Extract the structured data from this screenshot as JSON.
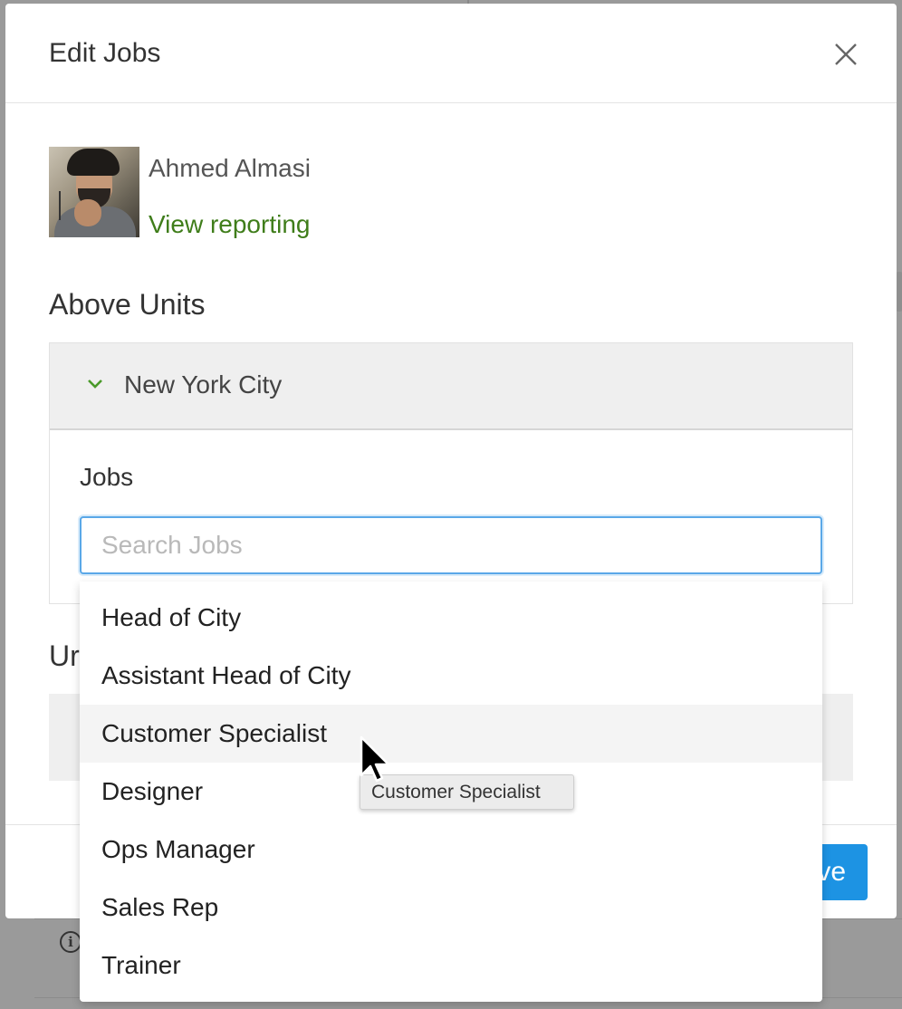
{
  "modal": {
    "title": "Edit Jobs"
  },
  "user": {
    "name": "Ahmed Almasi",
    "view_reporting_link": "View reporting"
  },
  "above_units": {
    "section_title": "Above Units",
    "accordion_label": "New York City",
    "jobs_label": "Jobs",
    "search_placeholder": "Search Jobs",
    "search_value": ""
  },
  "units": {
    "section_title_partial": "Ur"
  },
  "footer": {
    "save_label_partial": "ve"
  },
  "dropdown": {
    "options": [
      "Head of City",
      "Assistant Head of City",
      "Customer Specialist",
      "Designer",
      "Ops Manager",
      "Sales Rep",
      "Trainer"
    ],
    "hovered_option": "Customer Specialist"
  },
  "tooltip": {
    "text": "Customer Specialist"
  },
  "colors": {
    "accent_blue": "#1d93e3",
    "link_green": "#3f7d1a",
    "focus_border": "#5aa8e8"
  },
  "icons": {
    "close": "close-icon",
    "chevron": "chevron-down-icon",
    "info": "info-icon",
    "cursor": "mouse-pointer"
  }
}
